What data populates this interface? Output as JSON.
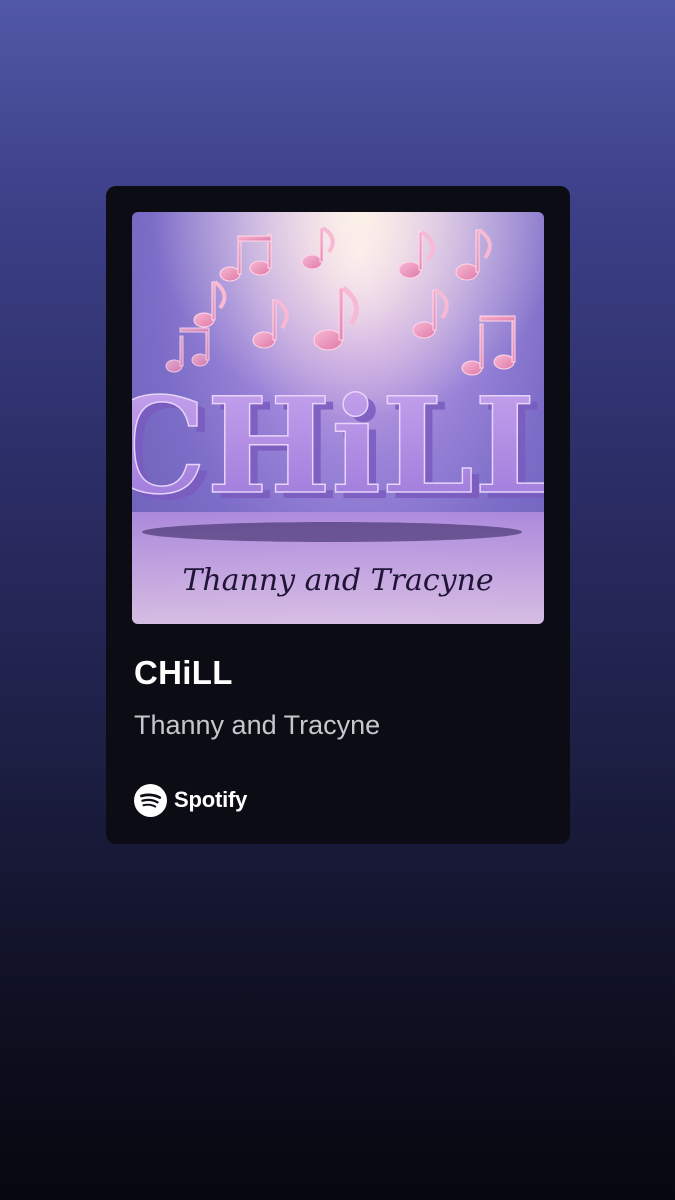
{
  "track": {
    "title": "CHiLL",
    "artist": "Thanny and Tracyne"
  },
  "cover_art": {
    "headline": "CHiLL",
    "signature": "Thanny and Tracyne"
  },
  "brand": {
    "name": "Spotify",
    "icon": "spotify-logo-icon"
  },
  "colors": {
    "background_top": "#5158a6",
    "background_bottom": "#07070f",
    "card": "#0c0c14",
    "title_text": "#ffffff",
    "artist_text": "#c6c6cd"
  }
}
